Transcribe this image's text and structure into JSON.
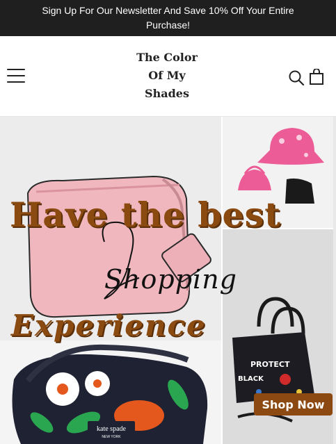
{
  "announcement": {
    "text": "Sign Up For Our Newsletter And Save 10% Off Your Entire Purchase!"
  },
  "header": {
    "logo_lines": [
      "The Color",
      "Of My",
      "Shades"
    ],
    "menu_icon": "hamburger-menu-icon",
    "search_icon": "search-icon",
    "cart_icon": "shopping-bag-icon"
  },
  "hero": {
    "line1": "Have the best",
    "script": "Shopping",
    "line2": "Experience",
    "cta_label": "Shop Now",
    "brand_bag_text": "kate spade",
    "brand_bag_sub": "NEW YORK",
    "tote_words": [
      "PROTECT",
      "BLACK"
    ],
    "accent_color": "#8c4a12"
  }
}
